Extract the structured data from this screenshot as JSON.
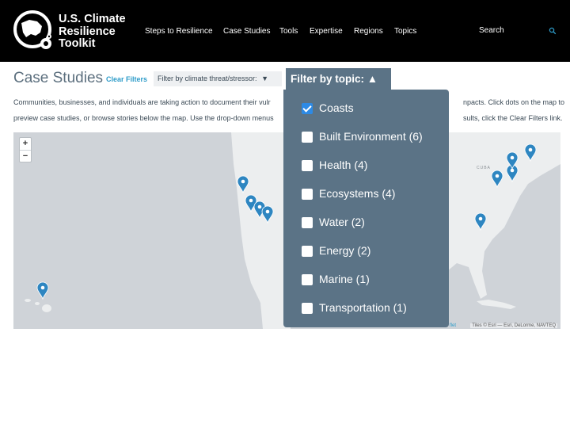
{
  "header": {
    "logo_line1": "U.S. Climate",
    "logo_line2": "Resilience",
    "logo_line3": "Toolkit",
    "nav": [
      {
        "label": "Steps to Resilience"
      },
      {
        "label": "Case Studies"
      },
      {
        "label": "Tools"
      },
      {
        "label": "Expertise"
      },
      {
        "label": "Regions"
      },
      {
        "label": "Topics"
      }
    ],
    "search_label": "Search",
    "search_icon": "search-icon"
  },
  "main": {
    "title": "Case Studies",
    "clear_filters": "Clear Filters",
    "threat_filter_label": "Filter by climate threat/stressor:",
    "threat_filter_arrow": "▼",
    "intro_line1_left": "Communities, businesses, and individuals are taking action to document their vulr",
    "intro_line1_right": "npacts. Click dots on the map to",
    "intro_line2_left": "preview case studies, or browse stories below the map. Use the drop-down menus",
    "intro_line2_right": "sults, click the Clear Filters link."
  },
  "topic_filter": {
    "toggle_label": "Filter by topic: ▲",
    "options": [
      {
        "label": "Coasts",
        "checked": true
      },
      {
        "label": "Built Environment (6)",
        "checked": false
      },
      {
        "label": "Health (4)",
        "checked": false
      },
      {
        "label": "Ecosystems (4)",
        "checked": false
      },
      {
        "label": "Water (2)",
        "checked": false
      },
      {
        "label": "Energy (2)",
        "checked": false
      },
      {
        "label": "Marine (1)",
        "checked": false
      },
      {
        "label": "Transportation (1)",
        "checked": false
      }
    ]
  },
  "map": {
    "zoom_in": "+",
    "zoom_out": "−",
    "attribution": "Tiles © Esri — Esri, DeLorme, NAVTEQ",
    "attribution_left": "flet",
    "cuba_label": "CUBA",
    "marker_color": "#2e86c1",
    "land_color": "#eceeef",
    "water_color": "#cfd3d8"
  },
  "colors": {
    "header_bg": "#000000",
    "dropdown_bg": "#5b7386",
    "link": "#2e9cc9",
    "title": "#5c6f7e"
  }
}
